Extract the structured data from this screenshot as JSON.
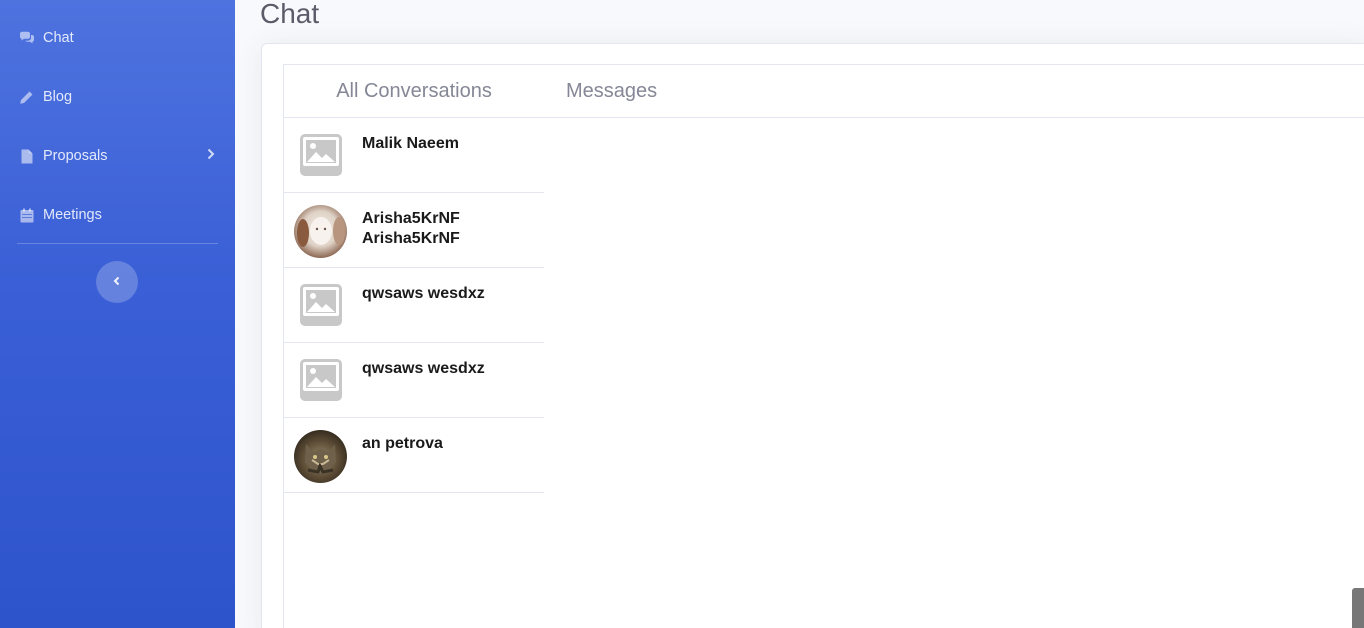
{
  "sidebar": {
    "items": [
      {
        "label": "Chat",
        "icon": "comments-icon"
      },
      {
        "label": "Blog",
        "icon": "pencil-icon"
      },
      {
        "label": "Proposals",
        "icon": "file-icon"
      },
      {
        "label": "Meetings",
        "icon": "calendar-icon"
      }
    ],
    "toggle_icon": "chevron-left-icon"
  },
  "page": {
    "title": "Chat"
  },
  "conversations": {
    "header": "All Conversations",
    "items": [
      {
        "name": "Malik Naeem",
        "avatar": "placeholder-image"
      },
      {
        "name": "Arisha5KrNF Arisha5KrNF",
        "avatar": "photo"
      },
      {
        "name": "qwsaws wesdxz",
        "avatar": "placeholder-image"
      },
      {
        "name": "qwsaws wesdxz",
        "avatar": "placeholder-image"
      },
      {
        "name": "an petrova",
        "avatar": "photo"
      }
    ]
  },
  "messages": {
    "header": "Messages"
  },
  "colors": {
    "sidebar_top": "#4e73df",
    "sidebar_bottom": "#2e54cc",
    "muted_text": "#858796"
  }
}
